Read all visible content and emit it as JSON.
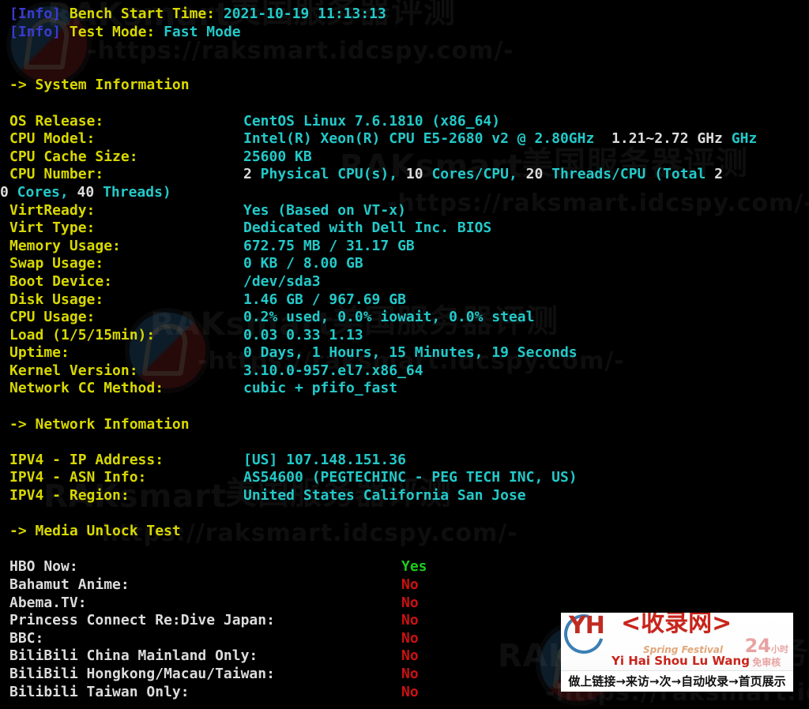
{
  "meta": {
    "background_color": "#000000",
    "colors": {
      "info_tag": "#3b3bcf",
      "label": "#d8d800",
      "value": "#23c9c9",
      "number": "#dcdcdc",
      "yes": "#1ecb1e",
      "no": "#cc1111"
    }
  },
  "header": {
    "lines": [
      {
        "tag": "[Info]",
        "label": "Bench Start Time:",
        "value": "2021-10-19 11:13:13"
      },
      {
        "tag": "[Info]",
        "label": "Test Mode:",
        "value": "Fast Mode"
      }
    ]
  },
  "sections": [
    {
      "title": "-> System Information",
      "rows": [
        {
          "label": "OS Release:",
          "value": "CentOS Linux 7.6.1810 (x86_64)"
        },
        {
          "label": "CPU Model:",
          "value": "Intel(R) Xeon(R) CPU E5-2680 v2 @ 2.80GHz",
          "extra": "1.21~2.72 GHz"
        },
        {
          "label": "CPU Cache Size:",
          "value": "25600 KB"
        },
        {
          "label": "CPU Number:",
          "value": "2 Physical CPU(s), 10 Cores/CPU, 20 Threads/CPU (Total 20 Cores, 40 Threads)"
        },
        {
          "label": "VirtReady:",
          "value": "Yes (Based on VT-x)"
        },
        {
          "label": "Virt Type:",
          "value": "Dedicated with Dell Inc. BIOS"
        },
        {
          "label": "Memory Usage:",
          "value": "672.75 MB / 31.17 GB"
        },
        {
          "label": "Swap Usage:",
          "value": "0 KB / 8.00 GB"
        },
        {
          "label": "Boot Device:",
          "value": "/dev/sda3"
        },
        {
          "label": "Disk Usage:",
          "value": "1.46 GB / 967.69 GB"
        },
        {
          "label": "CPU Usage:",
          "value": "0.2% used, 0.0% iowait, 0.0% steal"
        },
        {
          "label": "Load (1/5/15min):",
          "value": "0.03 0.33 1.13"
        },
        {
          "label": "Uptime:",
          "value": "0 Days, 1 Hours, 15 Minutes, 19 Seconds"
        },
        {
          "label": "Kernel Version:",
          "value": "3.10.0-957.el7.x86_64"
        },
        {
          "label": "Network CC Method:",
          "value": "cubic + pfifo_fast"
        }
      ]
    },
    {
      "title": "-> Network Infomation",
      "rows": [
        {
          "label": "IPV4 - IP Address:",
          "value": "[US] 107.148.151.36"
        },
        {
          "label": "IPV4 - ASN Info:",
          "value": "AS54600 (PEGTECHINC - PEG TECH INC, US)"
        },
        {
          "label": "IPV4 - Region:",
          "value": "United States California San Jose"
        }
      ]
    },
    {
      "title": "-> Media Unlock Test",
      "rows": [
        {
          "label": "HBO Now:",
          "value": "Yes",
          "state": "yes"
        },
        {
          "label": "Bahamut Anime:",
          "value": "No",
          "state": "no"
        },
        {
          "label": "Abema.TV:",
          "value": "No",
          "state": "no"
        },
        {
          "label": "Princess Connect Re:Dive Japan:",
          "value": "No",
          "state": "no"
        },
        {
          "label": "BBC:",
          "value": "No",
          "state": "no"
        },
        {
          "label": "BiliBili China Mainland Only:",
          "value": "No",
          "state": "no"
        },
        {
          "label": "BiliBili Hongkong/Macau/Taiwan:",
          "value": "No",
          "state": "no"
        },
        {
          "label": "Bilibili Taiwan Only:",
          "value": "No",
          "state": "no"
        }
      ]
    }
  ],
  "cpu_number_parts": [
    {
      "t": "2",
      "k": "num"
    },
    {
      "t": " Physical CPU(s), ",
      "k": "txt"
    },
    {
      "t": "10",
      "k": "num"
    },
    {
      "t": " Cores/CPU, ",
      "k": "txt"
    },
    {
      "t": "20",
      "k": "num"
    },
    {
      "t": " Threads/CPU (Total ",
      "k": "txt"
    },
    {
      "t": "2",
      "k": "num"
    }
  ],
  "cpu_number_wrap": [
    {
      "t": "0",
      "k": "num"
    },
    {
      "t": " Cores, ",
      "k": "txt"
    },
    {
      "t": "40",
      "k": "num"
    },
    {
      "t": " Threads)",
      "k": "txt"
    }
  ],
  "watermarks": {
    "cn_text": "美国服务器评测",
    "brand_text": "RAKsmart",
    "url_text": "-https://raksmart.idcspy.com/-"
  },
  "banner": {
    "logo_latin": "YH",
    "logo_cn": "<收录网>",
    "spring": "Spring Festival",
    "pinyin": "Yi Hai Shou Lu Wang",
    "badge_number": "24",
    "badge_hour": "小时",
    "badge_sub": "免审核",
    "strip_text": "做上链接→来访→次→自动收录→首页展示"
  }
}
